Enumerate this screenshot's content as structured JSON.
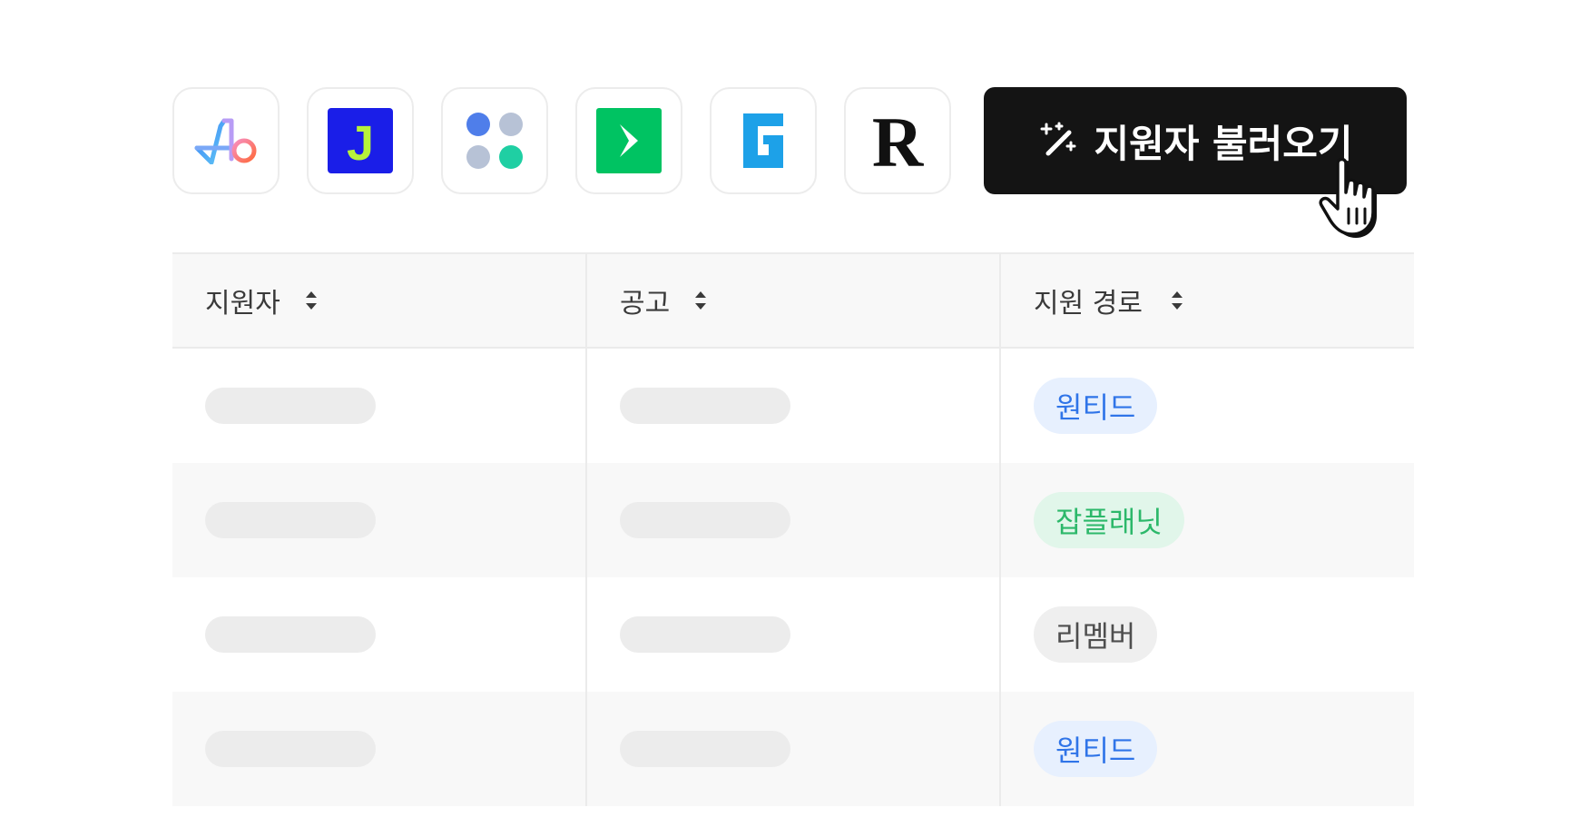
{
  "colors": {
    "button_bg": "#141414",
    "button_text": "#ffffff",
    "tag_wanted_bg": "#e7f0fe",
    "tag_wanted_text": "#2f74e8",
    "tag_jobplanet_bg": "#e1f6ea",
    "tag_jobplanet_text": "#2cb86a",
    "tag_remember_bg": "#efefef",
    "tag_remember_text": "#4e4e4e"
  },
  "toolbar": {
    "sources": [
      {
        "name": "wanted",
        "icon": "wanted-logo-icon"
      },
      {
        "name": "jobkorea",
        "icon": "jobkorea-logo-icon",
        "letter": "J"
      },
      {
        "name": "dots",
        "icon": "four-dots-logo-icon"
      },
      {
        "name": "jobplanet",
        "icon": "jobplanet-logo-icon"
      },
      {
        "name": "g-service",
        "icon": "g-logo-icon",
        "letter": "G"
      },
      {
        "name": "remember",
        "icon": "remember-logo-icon",
        "letter": "R"
      }
    ],
    "import_button": {
      "label": "지원자 불러오기",
      "icon": "magic-wand-icon"
    }
  },
  "table": {
    "columns": [
      {
        "label": "지원자",
        "icon": "sort-icon"
      },
      {
        "label": "공고",
        "icon": "sort-icon"
      },
      {
        "label": "지원 경로",
        "icon": "sort-icon"
      }
    ],
    "rows": [
      {
        "source": "원티드",
        "tag": "wanted"
      },
      {
        "source": "잡플래닛",
        "tag": "jobplanet"
      },
      {
        "source": "리멤버",
        "tag": "remember"
      },
      {
        "source": "원티드",
        "tag": "wanted"
      }
    ]
  }
}
